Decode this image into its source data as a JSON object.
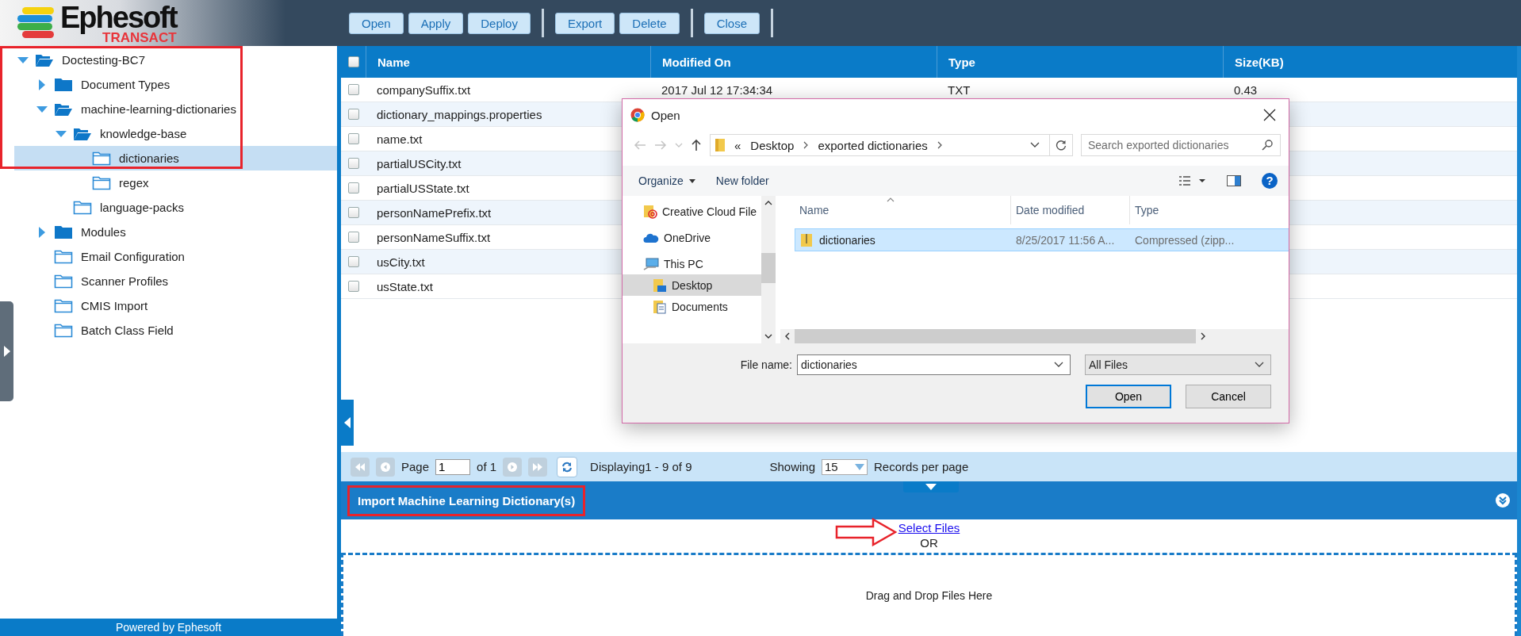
{
  "logo": {
    "name": "Ephesoft",
    "tagline": "TRANSACT"
  },
  "toolbar": [
    [
      "Open",
      "Apply",
      "Deploy"
    ],
    [
      "Export",
      "Delete"
    ],
    [
      "Close"
    ]
  ],
  "tree": [
    {
      "label": "Doctesting-BC7",
      "expanded": true,
      "selected": false,
      "children": [
        {
          "label": "Document Types",
          "expanded": false,
          "selected": false
        },
        {
          "label": "machine-learning-dictionaries",
          "expanded": true,
          "selected": false,
          "children": [
            {
              "label": "knowledge-base",
              "expanded": true,
              "selected": false,
              "children": [
                {
                  "label": "dictionaries",
                  "selected": true
                },
                {
                  "label": "regex",
                  "selected": false
                }
              ]
            },
            {
              "label": "language-packs",
              "selected": false
            }
          ]
        },
        {
          "label": "Modules",
          "expanded": false,
          "selected": false
        },
        {
          "label": "Email Configuration",
          "selected": false
        },
        {
          "label": "Scanner Profiles",
          "selected": false
        },
        {
          "label": "CMIS Import",
          "selected": false
        },
        {
          "label": "Batch Class Field",
          "selected": false
        }
      ]
    }
  ],
  "footer": "Powered by Ephesoft",
  "table": {
    "all_checked": false,
    "columns": [
      "Name",
      "Modified On",
      "Type",
      "Size(KB)"
    ],
    "rows": [
      {
        "checked": false,
        "cells": [
          "companySuffix.txt",
          "2017 Jul 12 17:34:34",
          "TXT",
          "0.43"
        ]
      },
      {
        "checked": false,
        "cells": [
          "dictionary_mappings.properties"
        ]
      },
      {
        "checked": false,
        "cells": [
          "name.txt"
        ]
      },
      {
        "checked": false,
        "cells": [
          "partialUSCity.txt"
        ]
      },
      {
        "checked": false,
        "cells": [
          "partialUSState.txt"
        ]
      },
      {
        "checked": false,
        "cells": [
          "personNamePrefix.txt"
        ]
      },
      {
        "checked": false,
        "cells": [
          "personNameSuffix.txt"
        ]
      },
      {
        "checked": false,
        "cells": [
          "usCity.txt"
        ]
      },
      {
        "checked": false,
        "cells": [
          "usState.txt"
        ]
      }
    ]
  },
  "pager": {
    "page_label": "Page",
    "page": "1",
    "of": "of 1",
    "displaying": "Displaying1 - 9 of 9",
    "showing": "Showing",
    "per_page": "15",
    "records_label": "Records per page"
  },
  "import_panel": {
    "title": "Import Machine Learning Dictionary(s)",
    "link": "Select Files",
    "or": "OR",
    "drop_zone": "Drag and Drop Files Here"
  },
  "dialog": {
    "title": "Open",
    "address": {
      "overflow": "«",
      "crumbs": [
        "Desktop",
        "exported dictionaries"
      ]
    },
    "search_placeholder": "Search exported dictionaries",
    "organize": "Organize",
    "new_folder": "New folder",
    "help": "?",
    "nav": [
      {
        "label": "Creative Cloud File",
        "kind": "cloud-files",
        "selected": false
      },
      {
        "label": "OneDrive",
        "kind": "onedrive",
        "selected": false
      },
      {
        "label": "This PC",
        "kind": "pc",
        "selected": false,
        "children": [
          {
            "label": "Desktop",
            "kind": "desktop",
            "selected": true
          },
          {
            "label": "Documents",
            "kind": "documents",
            "selected": false
          }
        ]
      }
    ],
    "columns": [
      "Name",
      "Date modified",
      "Type"
    ],
    "files": [
      {
        "cells": [
          "dictionaries",
          "8/25/2017 11:56 A...",
          "Compressed (zipp..."
        ],
        "selected": true
      }
    ],
    "file_name_label": "File name:",
    "file_name": "dictionaries",
    "filter": "All Files",
    "buttons": [
      "Open",
      "Cancel"
    ]
  }
}
